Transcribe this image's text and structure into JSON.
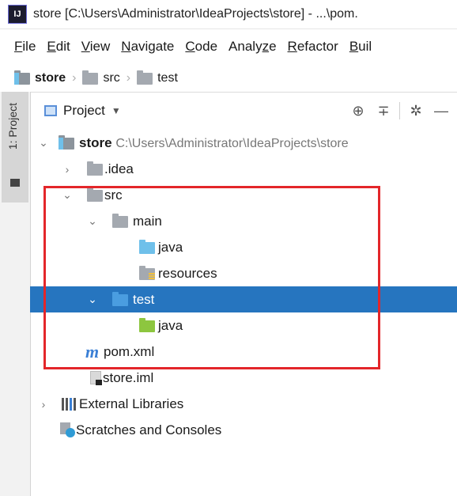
{
  "window": {
    "app_icon_text": "IJ",
    "title": "store [C:\\Users\\Administrator\\IdeaProjects\\store] - ...\\pom."
  },
  "menu": [
    {
      "first": "F",
      "rest": "ile"
    },
    {
      "first": "E",
      "rest": "dit"
    },
    {
      "first": "V",
      "rest": "iew"
    },
    {
      "first": "N",
      "rest": "avigate"
    },
    {
      "first": "C",
      "rest": "ode"
    },
    {
      "pre": "Analy",
      "first": "z",
      "rest": "e"
    },
    {
      "first": "R",
      "rest": "efactor"
    },
    {
      "first": "B",
      "rest": "uil"
    }
  ],
  "breadcrumb": [
    "store",
    "src",
    "test"
  ],
  "left_tab": {
    "label": "1: Project"
  },
  "panel": {
    "title": "Project",
    "icons": [
      "target-icon",
      "collapse-icon",
      "gear-icon",
      "minimize-icon"
    ]
  },
  "tree": {
    "root_label": "store",
    "root_path": "C:\\Users\\Administrator\\IdeaProjects\\store",
    "idea": ".idea",
    "src": "src",
    "main": "main",
    "main_java": "java",
    "resources": "resources",
    "test": "test",
    "test_java": "java",
    "pom": "pom.xml",
    "iml": "store.iml",
    "libraries": "External Libraries",
    "scratches": "Scratches and Consoles"
  },
  "colors": {
    "selection": "#2675bf",
    "highlight": "#e3262a"
  }
}
